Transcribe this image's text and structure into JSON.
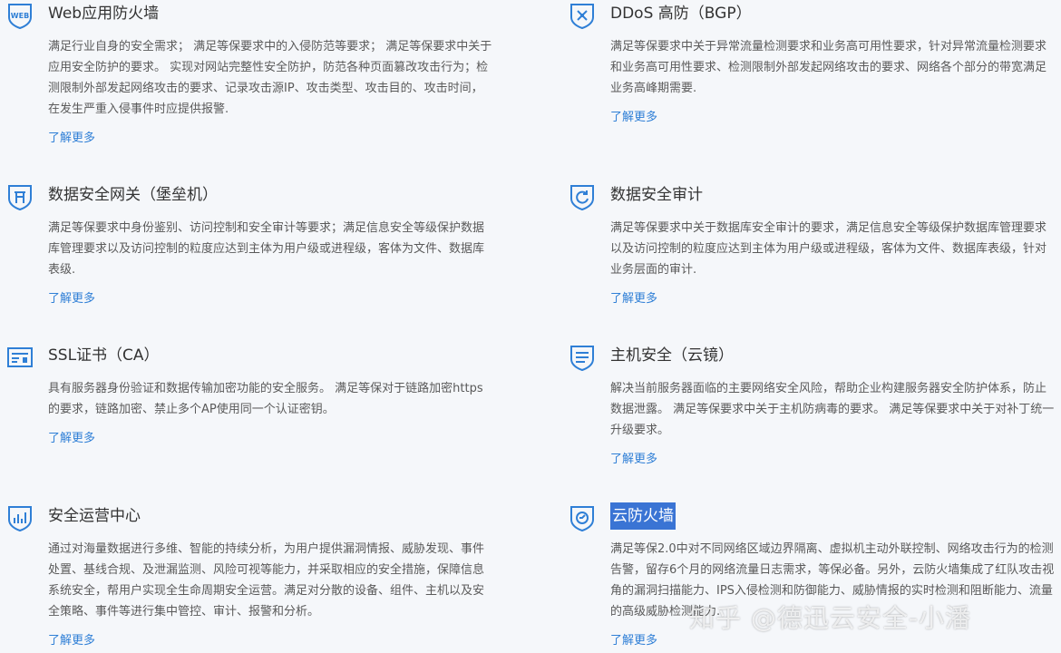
{
  "accent": "#2f7fd6",
  "cards": [
    {
      "icon": "web-shield-icon",
      "title": "Web应用防火墙",
      "desc": "满足行业自身的安全需求； 满足等保要求中的入侵防范等要求； 满足等保要求中关于应用安全防护的要求。 实现对网站完整性安全防护，防范各种页面篡改攻击行为；检测限制外部发起网络攻击的要求、记录攻击源IP、攻击类型、攻击目的、攻击时间，在发生严重入侵事件时应提供报警.",
      "more": "了解更多"
    },
    {
      "icon": "ddos-shield-icon",
      "title": "DDoS 高防（BGP）",
      "desc": "满足等保要求中关于异常流量检测要求和业务高可用性要求，针对异常流量检测要求和业务高可用性要求、检测限制外部发起网络攻击的要求、网络各个部分的带宽满足业务高峰期需要.",
      "more": "了解更多"
    },
    {
      "icon": "bastion-shield-icon",
      "title": "数据安全网关（堡垒机）",
      "desc": "满足等保要求中身份鉴别、访问控制和安全审计等要求；满足信息安全等级保护数据库管理要求以及访问控制的粒度应达到主体为用户级或进程级，客体为文件、数据库表级.",
      "more": "了解更多"
    },
    {
      "icon": "audit-shield-icon",
      "title": "数据安全审计",
      "desc": "满足等保要求中关于数据库安全审计的要求，满足信息安全等级保护数据库管理要求以及访问控制的粒度应达到主体为用户级或进程级，客体为文件、数据库表级，针对业务层面的审计.",
      "more": "了解更多"
    },
    {
      "icon": "ssl-certificate-icon",
      "title": "SSL证书（CA）",
      "desc": "具有服务器身份验证和数据传输加密功能的安全服务。 满足等保对于链路加密https的要求，链路加密、禁止多个AP使用同一个认证密钥。",
      "more": "了解更多"
    },
    {
      "icon": "host-security-icon",
      "title": "主机安全（云镜）",
      "desc": "解决当前服务器面临的主要网络安全风险，帮助企业构建服务器安全防护体系，防止数据泄露。 满足等保要求中关于主机防病毒的要求。 满足等保要求中关于对补丁统一升级要求。",
      "more": "了解更多"
    },
    {
      "icon": "soc-chart-icon",
      "title": "安全运营中心",
      "desc": "通过对海量数据进行多维、智能的持续分析，为用户提供漏洞情报、威胁发现、事件处置、基线合规、及泄漏监测、风险可视等能力，并采取相应的安全措施，保障信息系统安全，帮用户实现全生命周期安全运营。满足对分散的设备、组件、主机以及安全策略、事件等进行集中管控、审计、报警和分析。",
      "more": "了解更多"
    },
    {
      "icon": "cloud-firewall-icon",
      "title": "云防火墙",
      "desc": "满足等保2.0中对不同网络区域边界隔离、虚拟机主动外联控制、网络攻击行为的检测告警，留存6个月的网络流量日志需求，等保必备。另外，云防火墙集成了红队攻击视角的漏洞扫描能力、IPS入侵检测和防御能力、威胁情报的实时检测和阻断能力、流量的高级威胁检测能力.",
      "more": "了解更多"
    }
  ],
  "watermark": "知乎 @德迅云安全-小潘"
}
